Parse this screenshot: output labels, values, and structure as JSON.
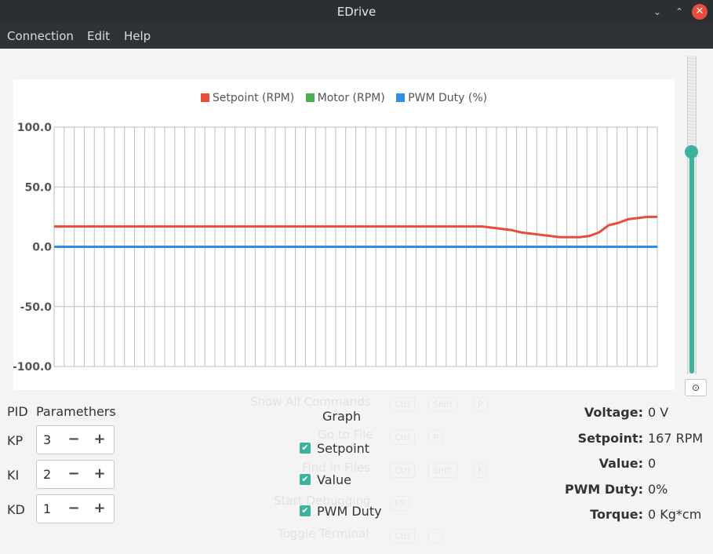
{
  "window": {
    "title": "EDrive",
    "minimize_icon": "minimize-icon",
    "maximize_icon": "maximize-icon",
    "close_icon": "close-icon"
  },
  "menu": {
    "items": [
      "Connection",
      "Edit",
      "Help"
    ]
  },
  "chart_data": {
    "type": "line",
    "legend": [
      "Setpoint (RPM)",
      "Motor (RPM)",
      "PWM Duty (%)"
    ],
    "legend_placement": "top-center",
    "colors": [
      "#e74c3c",
      "#4caf50",
      "#2f8fe0"
    ],
    "y_ticks": [
      "100.0",
      "50.0",
      "0.0",
      "-50.0",
      "-100.0"
    ],
    "ylim": [
      -100,
      100
    ],
    "grid": true,
    "x_count": 60,
    "series": [
      {
        "name": "Setpoint (RPM)",
        "values": [
          17,
          17,
          17,
          17,
          17,
          17,
          17,
          17,
          17,
          17,
          17,
          17,
          17,
          17,
          17,
          17,
          17,
          17,
          17,
          17,
          17,
          17,
          17,
          17,
          17,
          17,
          17,
          17,
          17,
          17,
          17,
          17,
          17,
          17,
          17,
          17,
          17,
          17,
          17,
          17,
          17,
          17,
          17,
          17,
          17,
          16,
          15,
          14,
          12,
          11,
          10,
          9,
          8,
          8,
          8,
          9,
          12,
          18,
          20,
          23,
          24,
          25,
          25
        ]
      },
      {
        "name": "PWM Duty (%)",
        "values": [
          0,
          0,
          0,
          0,
          0,
          0,
          0,
          0,
          0,
          0,
          0,
          0,
          0,
          0,
          0,
          0,
          0,
          0,
          0,
          0,
          0,
          0,
          0,
          0,
          0,
          0,
          0,
          0,
          0,
          0,
          0,
          0,
          0,
          0,
          0,
          0,
          0,
          0,
          0,
          0,
          0,
          0,
          0,
          0,
          0,
          0,
          0,
          0,
          0,
          0,
          0,
          0,
          0,
          0,
          0,
          0,
          0,
          0,
          0,
          0,
          0,
          0,
          0
        ]
      }
    ]
  },
  "slider": {
    "level_fraction": 0.7,
    "reset_icon": "reset-icon",
    "reset_symbol": "⊙"
  },
  "ghost_commands": [
    {
      "label": "Show All Commands",
      "keys": [
        "Ctrl",
        "+",
        "Shift",
        "+",
        "P"
      ]
    },
    {
      "label": "Go to File",
      "keys": [
        "Ctrl",
        "+",
        "P"
      ]
    },
    {
      "label": "Find in Files",
      "keys": [
        "Ctrl",
        "+",
        "Shift",
        "+",
        "F"
      ]
    },
    {
      "label": "Start Debugging",
      "keys": [
        "F5"
      ]
    },
    {
      "label": "Toggle Terminal",
      "keys": [
        "Ctrl",
        "+",
        "`"
      ]
    }
  ],
  "pid": {
    "title_a": "PID",
    "title_b": "Paramethers",
    "params": [
      {
        "label": "KP",
        "value": "3"
      },
      {
        "label": "KI",
        "value": "2"
      },
      {
        "label": "KD",
        "value": "1"
      }
    ],
    "minus": "−",
    "plus": "+"
  },
  "graph": {
    "title": "Graph",
    "options": [
      {
        "label": "Setpoint",
        "checked": true
      },
      {
        "label": "Value",
        "checked": true
      },
      {
        "label": "PWM Duty",
        "checked": true
      }
    ],
    "check_symbol": "✔"
  },
  "stats": [
    {
      "name": "Voltage:",
      "value": "0 V"
    },
    {
      "name": "Setpoint:",
      "value": "167 RPM"
    },
    {
      "name": "Value:",
      "value": "0"
    },
    {
      "name": "PWM Duty:",
      "value": "0%"
    },
    {
      "name": "Torque:",
      "value": "0 Kg*cm"
    }
  ]
}
